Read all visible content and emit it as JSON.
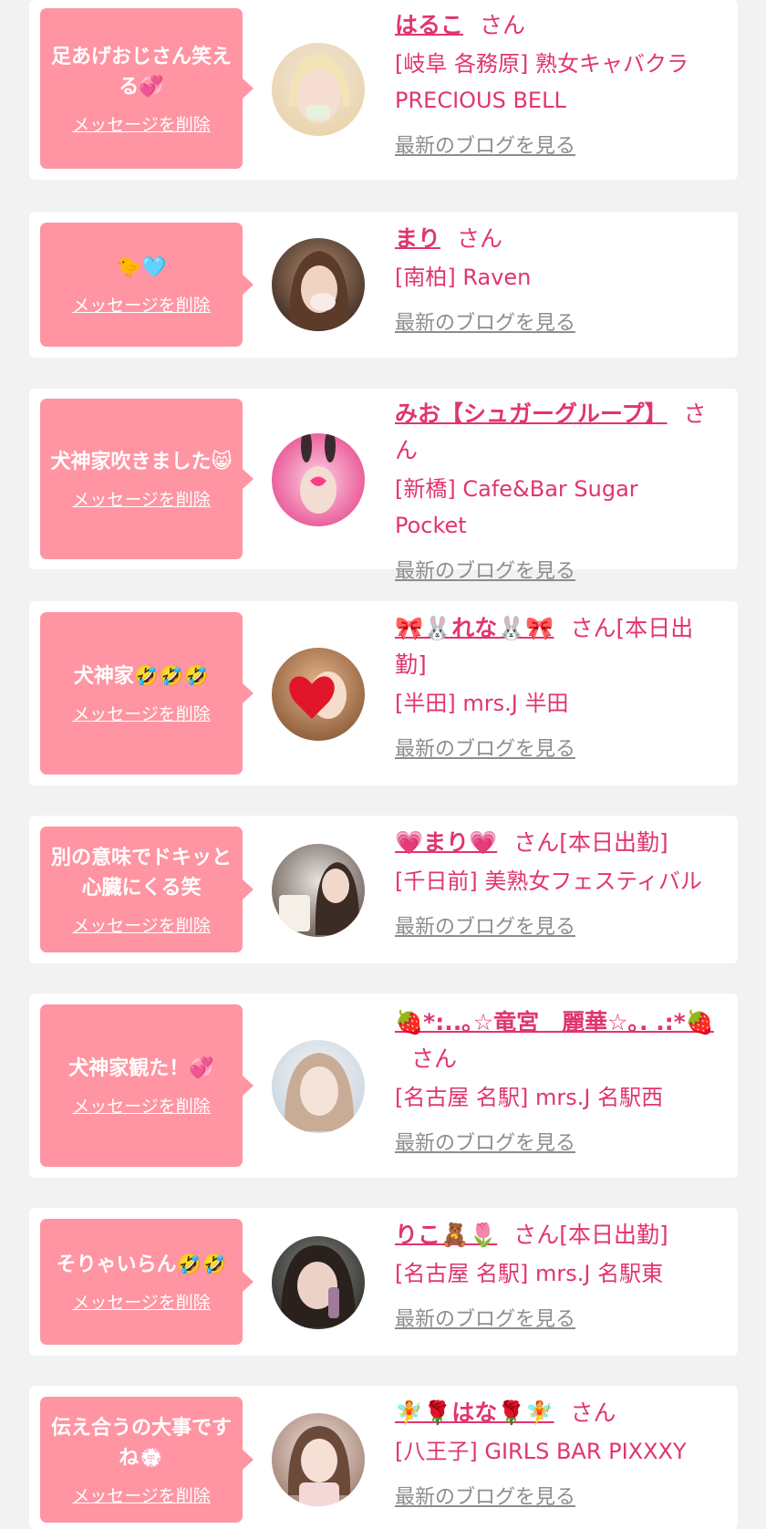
{
  "list": {
    "items": [
      {
        "message": "足あげおじさん笑える💞",
        "delete_label": "メッセージを削除",
        "name": "はるこ",
        "san": "さん",
        "shop": "[岐阜 各務原] 熟女キャバクラ PRECIOUS BELL",
        "blog_label": "最新のブログを見る",
        "avatar_colors": [
          "#efe6dc",
          "#e9d3a8"
        ]
      },
      {
        "message": "🐤🩵",
        "delete_label": "メッセージを削除",
        "name": "まり",
        "san": "さん",
        "shop": "[南柏] Raven",
        "blog_label": "最新のブログを見る",
        "avatar_colors": [
          "#3b2a22",
          "#b38b6c"
        ]
      },
      {
        "message": "犬神家吹きました😸",
        "delete_label": "メッセージを削除",
        "name": "みお【シュガーグループ】",
        "san": "さん",
        "shop": "[新橋] Cafe&Bar Sugar Pocket",
        "blog_label": "最新のブログを見る",
        "avatar_colors": [
          "#f7a7c9",
          "#e84a8f"
        ]
      },
      {
        "message": "犬神家🤣🤣🤣",
        "delete_label": "メッセージを削除",
        "name": "🎀🐰れな🐰🎀",
        "san": "さん[本日出勤]",
        "shop": "[半田] mrs.J 半田",
        "blog_label": "最新のブログを見る",
        "avatar_colors": [
          "#c98a55",
          "#e23a3a"
        ]
      },
      {
        "message": "別の意味でドキッと心臓にくる笑",
        "delete_label": "メッセージを削除",
        "name": "💗まり💗",
        "san": "さん[本日出勤]",
        "shop": "[千日前] 美熟女フェスティバル",
        "blog_label": "最新のブログを見る",
        "avatar_colors": [
          "#d9d6d4",
          "#6b5a52"
        ]
      },
      {
        "message": "犬神家観た！💞",
        "delete_label": "メッセージを削除",
        "name": "🍓*:..｡☆竜宮　麗華☆｡. .:*🍓",
        "san": "さん",
        "shop": "[名古屋 名駅] mrs.J 名駅西",
        "blog_label": "最新のブログを見る",
        "avatar_colors": [
          "#e9eef3",
          "#c6a58f"
        ]
      },
      {
        "message": "そりゃいらん🤣🤣",
        "delete_label": "メッセージを削除",
        "name": "りこ🧸🌷",
        "san": "さん[本日出勤]",
        "shop": "[名古屋 名駅] mrs.J 名駅東",
        "blog_label": "最新のブログを見る",
        "avatar_colors": [
          "#6e6f67",
          "#2b2b2b"
        ]
      },
      {
        "message": "伝え合うの大事ですね💮",
        "delete_label": "メッセージを削除",
        "name": "🧚🌹はな🌹🧚",
        "san": "さん",
        "shop": "[八王子] GIRLS BAR PIXXXY",
        "blog_label": "最新のブログを見る",
        "avatar_colors": [
          "#caa79a",
          "#f1e4df"
        ]
      }
    ]
  }
}
